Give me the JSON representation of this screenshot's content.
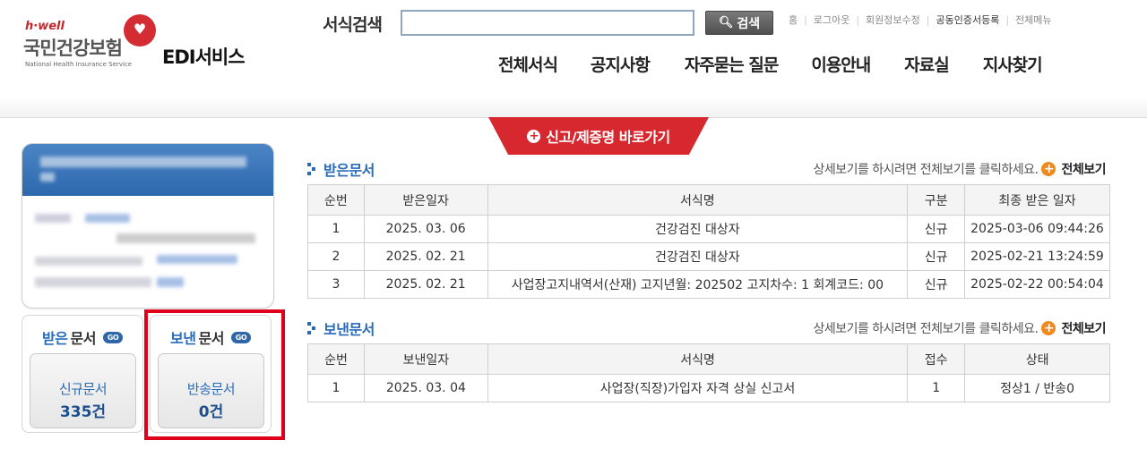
{
  "header": {
    "logo": {
      "tagline": "h·well",
      "name_ko": "국민건강보험",
      "name_en": "National Health Insurance Service"
    },
    "service_title": "EDI서비스",
    "search": {
      "label": "서식검색",
      "value": "",
      "placeholder": "",
      "button": "검색"
    },
    "util_links": [
      "홈",
      "로그아웃",
      "회원정보수정",
      "공동인증서등록",
      "전체메뉴"
    ],
    "nav": [
      "전체서식",
      "공지사항",
      "자주묻는 질문",
      "이용안내",
      "자료실",
      "지사찾기"
    ],
    "report_button": "신고/제증명 바로가기"
  },
  "left": {
    "received": {
      "title_em": "받은",
      "title_rest": "문서",
      "go": "GO",
      "card_label": "신규문서",
      "card_count": "335건"
    },
    "sent": {
      "title_em": "보낸",
      "title_rest": "문서",
      "go": "GO",
      "card_label": "반송문서",
      "card_count": "0건"
    }
  },
  "received_section": {
    "title": "받은문서",
    "hint": "상세보기를 하시려면 전체보기를 클릭하세요.",
    "more": "전체보기",
    "columns": [
      "순번",
      "받은일자",
      "서식명",
      "구분",
      "최종 받은 일자"
    ],
    "rows": [
      [
        "1",
        "2025. 03. 06",
        "건강검진 대상자",
        "신규",
        "2025-03-06 09:44:26"
      ],
      [
        "2",
        "2025. 02. 21",
        "건강검진 대상자",
        "신규",
        "2025-02-21 13:24:59"
      ],
      [
        "3",
        "2025. 02. 21",
        "사업장고지내역서(산재) 고지년월: 202502 고지차수: 1 회계코드: 00",
        "신규",
        "2025-02-22 00:54:04"
      ]
    ]
  },
  "sent_section": {
    "title": "보낸문서",
    "hint": "상세보기를 하시려면 전체보기를 클릭하세요.",
    "more": "전체보기",
    "columns": [
      "순번",
      "보낸일자",
      "서식명",
      "접수",
      "상태"
    ],
    "rows": [
      [
        "1",
        "2025. 03. 04",
        "사업장(직장)가입자 자격 상실 신고서",
        "1",
        "정상1 / 반송0"
      ]
    ]
  },
  "colors": {
    "brand_red": "#d7282f",
    "link_blue": "#2a6bb8",
    "highlight": "#e0001b"
  }
}
